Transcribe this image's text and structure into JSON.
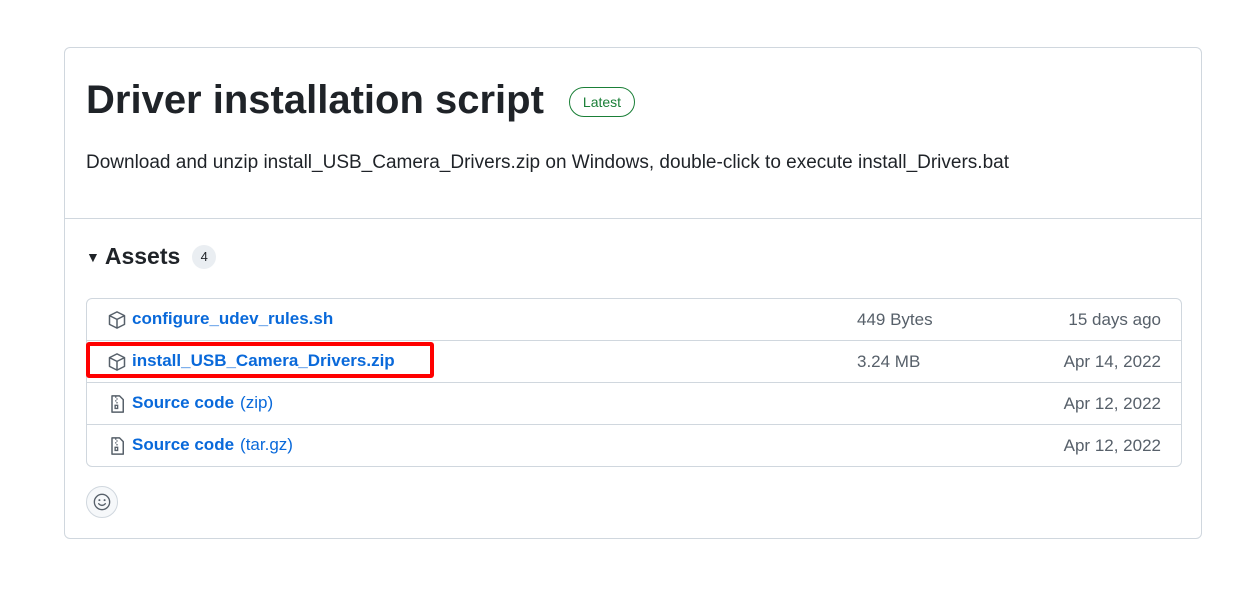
{
  "release": {
    "title": "Driver installation script",
    "badge": "Latest",
    "description": "Download and unzip install_USB_Camera_Drivers.zip on Windows, double-click to execute install_Drivers.bat"
  },
  "assets": {
    "title": "Assets",
    "count": "4",
    "items": [
      {
        "name": "configure_udev_rules.sh",
        "ext": "",
        "size": "449 Bytes",
        "date": "15 days ago",
        "icon": "package-icon"
      },
      {
        "name": "install_USB_Camera_Drivers.zip",
        "ext": "",
        "size": "3.24 MB",
        "date": "Apr 14, 2022",
        "icon": "package-icon"
      },
      {
        "name": "Source code",
        "ext": "(zip)",
        "size": "",
        "date": "Apr 12, 2022",
        "icon": "file-zip-icon"
      },
      {
        "name": "Source code",
        "ext": "(tar.gz)",
        "size": "",
        "date": "Apr 12, 2022",
        "icon": "file-zip-icon"
      }
    ]
  },
  "colors": {
    "link": "#0969da",
    "latest": "#1a7f37",
    "highlight": "#ff0000"
  }
}
